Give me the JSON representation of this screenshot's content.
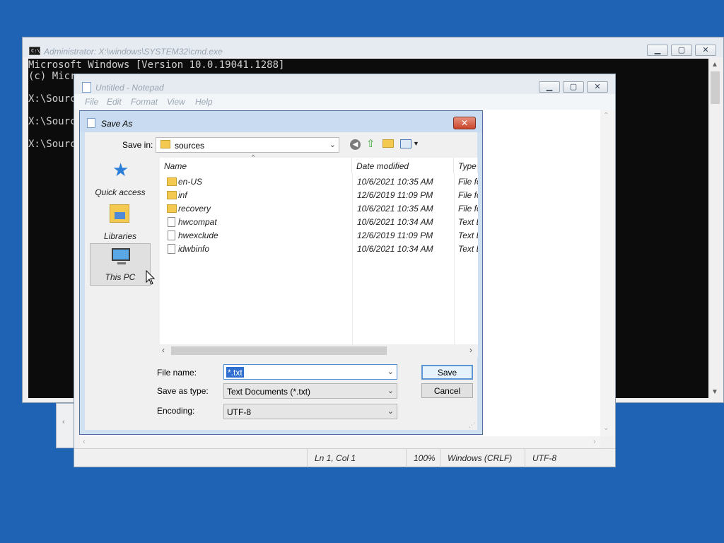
{
  "cmd": {
    "title": "Administrator: X:\\windows\\SYSTEM32\\cmd.exe",
    "lines": [
      "Microsoft Windows [Version 10.0.19041.1288]",
      "(c) Micro",
      "",
      "X:\\Sourc",
      "",
      "X:\\Sourc",
      "",
      "X:\\Sourc"
    ]
  },
  "notepad": {
    "title": "Untitled - Notepad",
    "menu": [
      "File",
      "Edit",
      "Format",
      "View",
      "Help"
    ],
    "status": {
      "position": "Ln 1, Col 1",
      "zoom": "100%",
      "line_ending": "Windows (CRLF)",
      "encoding": "UTF-8"
    }
  },
  "dialog": {
    "title": "Save As",
    "save_in_label": "Save in:",
    "save_in_value": "sources",
    "nav": [
      "Quick access",
      "Libraries",
      "This PC"
    ],
    "columns": [
      "Name",
      "Date modified",
      "Type"
    ],
    "files": [
      {
        "name": "en-US",
        "date": "10/6/2021 10:35 AM",
        "type": "File fo",
        "kind": "folder"
      },
      {
        "name": "inf",
        "date": "12/6/2019 11:09 PM",
        "type": "File fo",
        "kind": "folder"
      },
      {
        "name": "recovery",
        "date": "10/6/2021 10:35 AM",
        "type": "File fo",
        "kind": "folder"
      },
      {
        "name": "hwcompat",
        "date": "10/6/2021 10:34 AM",
        "type": "Text D",
        "kind": "file"
      },
      {
        "name": "hwexclude",
        "date": "12/6/2019 11:09 PM",
        "type": "Text D",
        "kind": "file"
      },
      {
        "name": "idwbinfo",
        "date": "10/6/2021 10:34 AM",
        "type": "Text D",
        "kind": "file"
      }
    ],
    "file_name_label": "File name:",
    "file_name_value": "*.txt",
    "save_as_type_label": "Save as type:",
    "save_as_type_value": "Text Documents (*.txt)",
    "encoding_label": "Encoding:",
    "encoding_value": "UTF-8",
    "save_label": "Save",
    "cancel_label": "Cancel"
  }
}
